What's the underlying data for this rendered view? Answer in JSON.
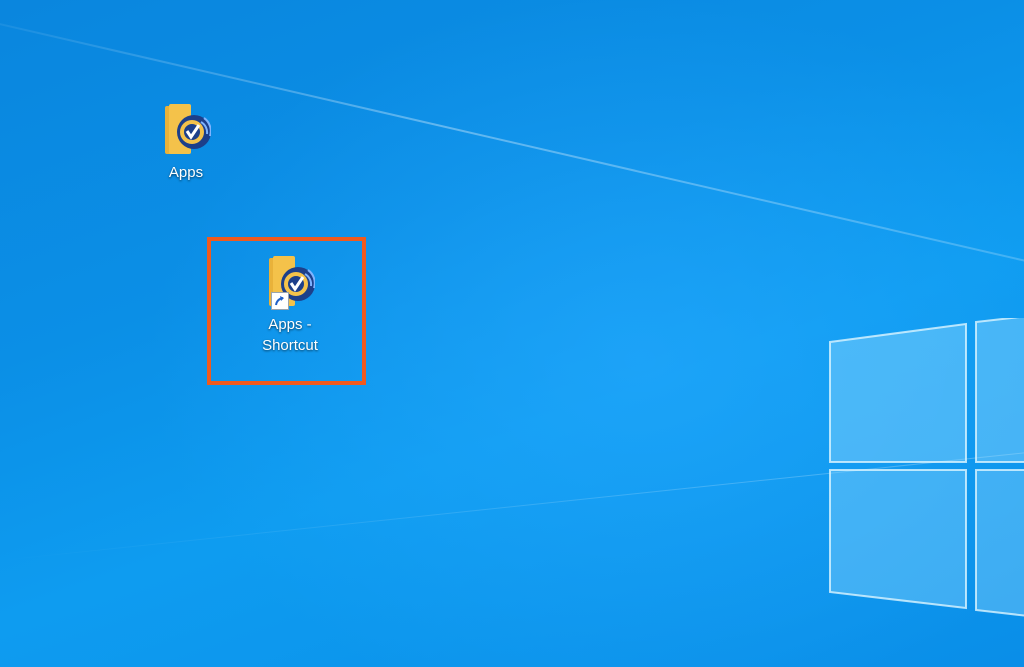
{
  "desktop": {
    "icons": [
      {
        "label": "Apps",
        "icon": "folder-icon"
      },
      {
        "label": "Apps - Shortcut",
        "icon": "folder-shortcut-icon"
      }
    ]
  },
  "colors": {
    "highlight": "#f05a1e",
    "folder": "#f4c24a",
    "badge": "#1d3f8a"
  }
}
